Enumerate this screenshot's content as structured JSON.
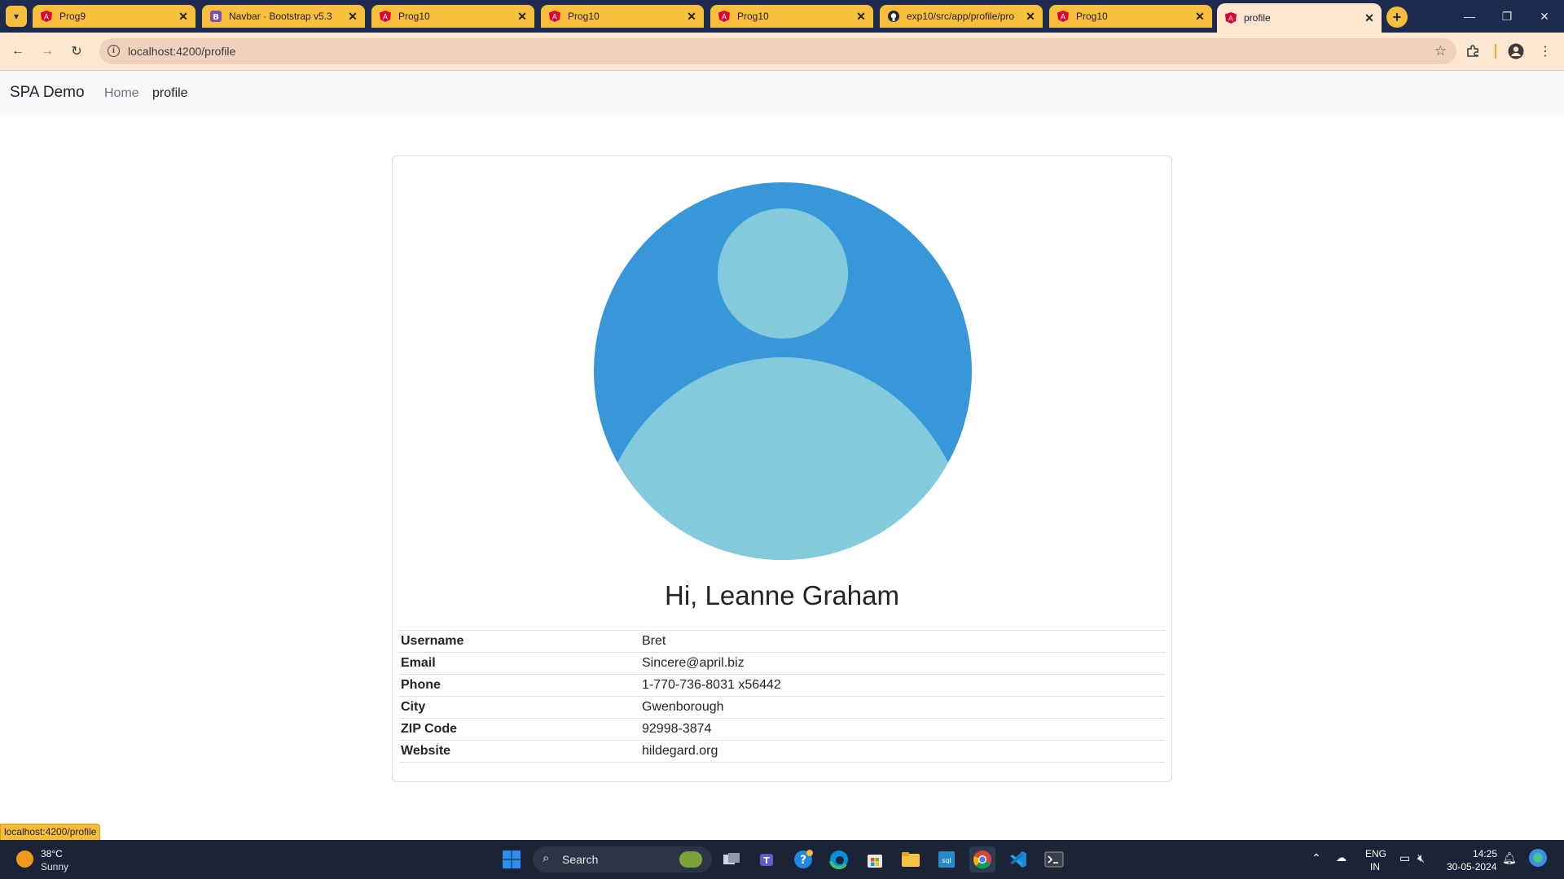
{
  "browser": {
    "tabs": [
      {
        "title": "Prog9",
        "icon": "angular-icon",
        "active": false
      },
      {
        "title": "Navbar · Bootstrap v5.3",
        "icon": "bootstrap-icon",
        "active": false
      },
      {
        "title": "Prog10",
        "icon": "angular-icon",
        "active": false
      },
      {
        "title": "Prog10",
        "icon": "angular-icon",
        "active": false
      },
      {
        "title": "Prog10",
        "icon": "angular-icon",
        "active": false
      },
      {
        "title": "exp10/src/app/profile/pro",
        "icon": "github-icon",
        "active": false
      },
      {
        "title": "Prog10",
        "icon": "angular-icon",
        "active": false
      },
      {
        "title": "profile",
        "icon": "angular-icon",
        "active": true
      }
    ],
    "url": "localhost:4200/profile",
    "status_url": "localhost:4200/profile"
  },
  "app": {
    "brand": "SPA Demo",
    "nav": [
      {
        "label": "Home",
        "active": false
      },
      {
        "label": "profile",
        "active": true
      }
    ]
  },
  "profile": {
    "greeting": "Hi, Leanne Graham",
    "fields": [
      {
        "label": "Username",
        "value": "Bret"
      },
      {
        "label": "Email",
        "value": "Sincere@april.biz"
      },
      {
        "label": "Phone",
        "value": "1-770-736-8031 x56442"
      },
      {
        "label": "City",
        "value": "Gwenborough"
      },
      {
        "label": "ZIP Code",
        "value": "92998-3874"
      },
      {
        "label": "Website",
        "value": "hildegard.org"
      }
    ],
    "avatar_colors": {
      "background": "#3797d9",
      "figure": "#84cadd"
    }
  },
  "taskbar": {
    "weather": {
      "temp": "38°C",
      "condition": "Sunny"
    },
    "search_label": "Search",
    "lang": "ENG",
    "region": "IN",
    "time": "14:25",
    "date": "30-05-2024"
  },
  "colors": {
    "tab_bar": "#1c2a4f",
    "tab": "#f9be3d",
    "active_tab": "#fde7d1",
    "navbar_bg": "#f8f9fa"
  }
}
